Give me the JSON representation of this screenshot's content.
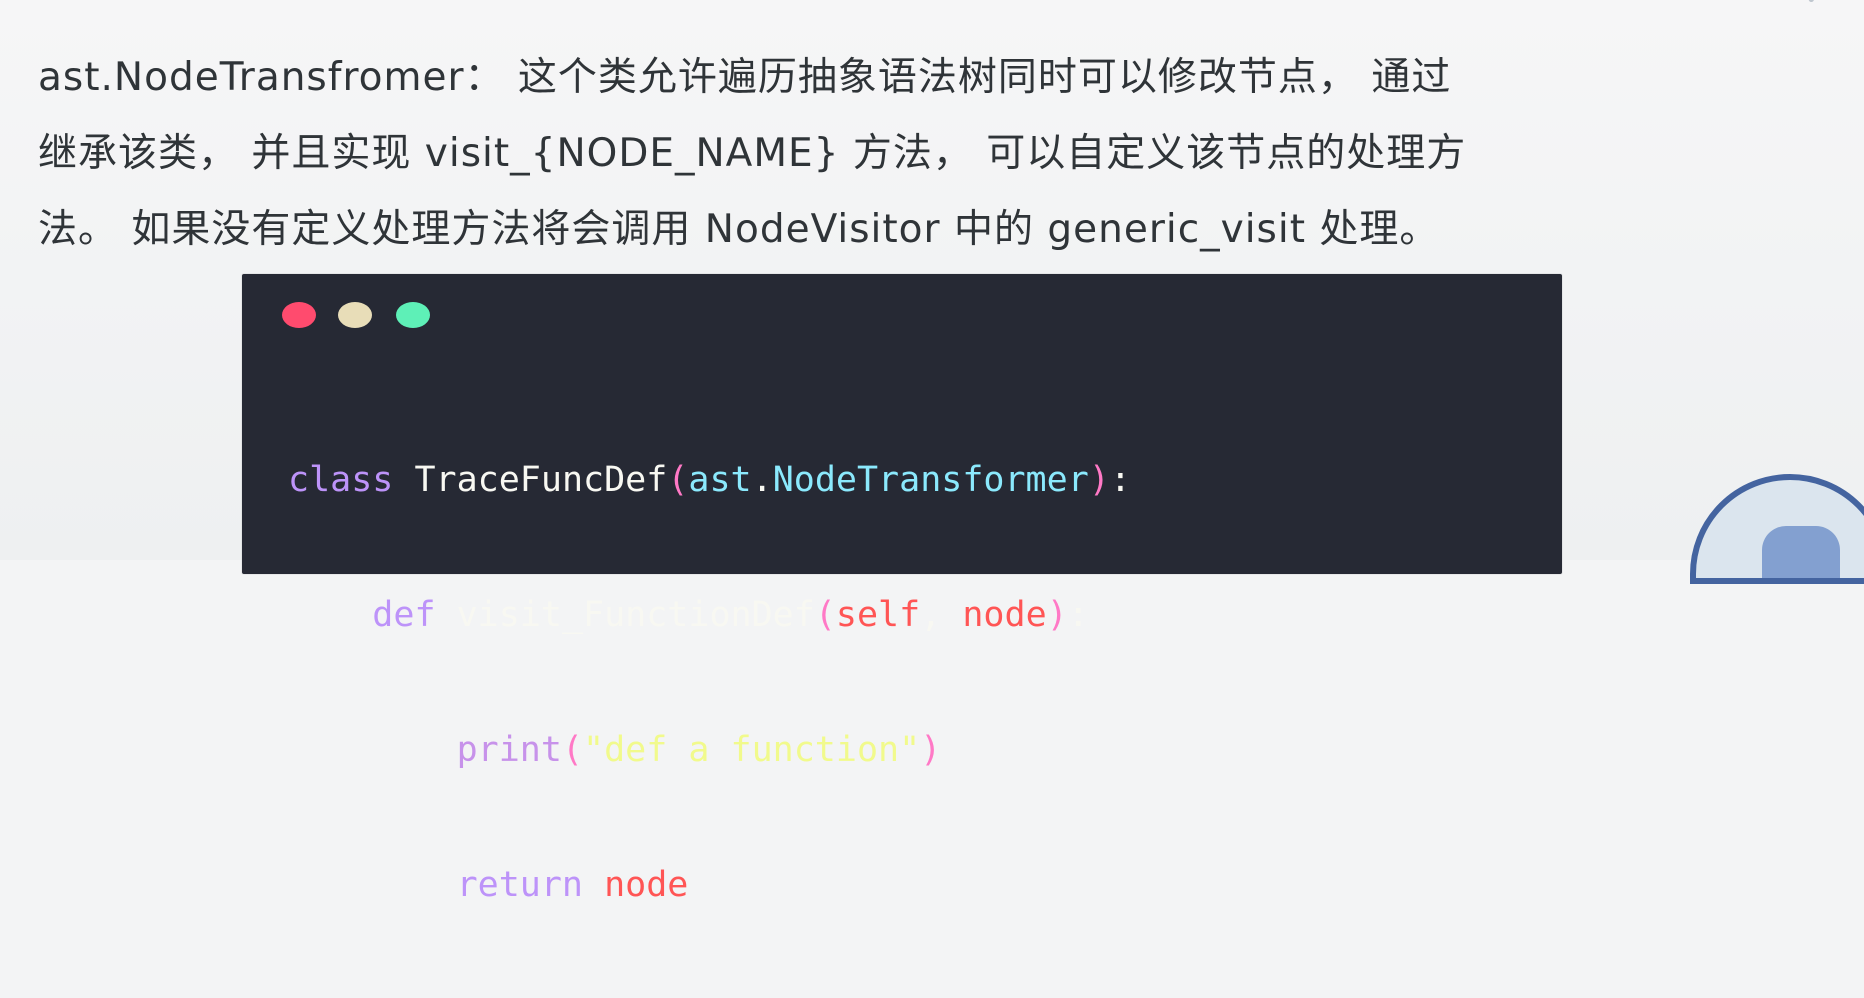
{
  "paragraph": {
    "line1": "ast.NodeTransfromer：  这个类允许遍历抽象语法树同时可以修改节点，  通过",
    "line2": "继承该类，  并且实现 visit_{NODE_NAME} 方法，  可以自定义该节点的处理方",
    "line3": "法。 如果没有定义处理方法将会调用 NodeVisitor 中的 generic_visit 处理。"
  },
  "code": {
    "l1_kw": "class",
    "l1_name": "TraceFuncDef",
    "l1_paren1": "(",
    "l1_mod": "ast",
    "l1_dot": ".",
    "l1_type": "NodeTransformer",
    "l1_paren2": ")",
    "l1_colon": ":",
    "l2_indent": "    ",
    "l2_kw": "def",
    "l2_name": "visit_FunctionDef",
    "l2_paren1": "(",
    "l2_self": "self",
    "l2_comma": ", ",
    "l2_node": "node",
    "l2_paren2": ")",
    "l2_colon": ":",
    "l3_indent": "        ",
    "l3_builtin": "print",
    "l3_paren1": "(",
    "l3_string": "\"def a function\"",
    "l3_paren2": ")",
    "l4_indent": "        ",
    "l4_kw": "return",
    "l4_node": "node"
  },
  "colors": {
    "window_background": "#262934",
    "dot_red": "#ff4b6e",
    "dot_yellow": "#e8ddb8",
    "dot_green": "#5ef0b7"
  },
  "icons": {
    "traffic_lights": "window-control-dots",
    "logo": "python-logo"
  }
}
